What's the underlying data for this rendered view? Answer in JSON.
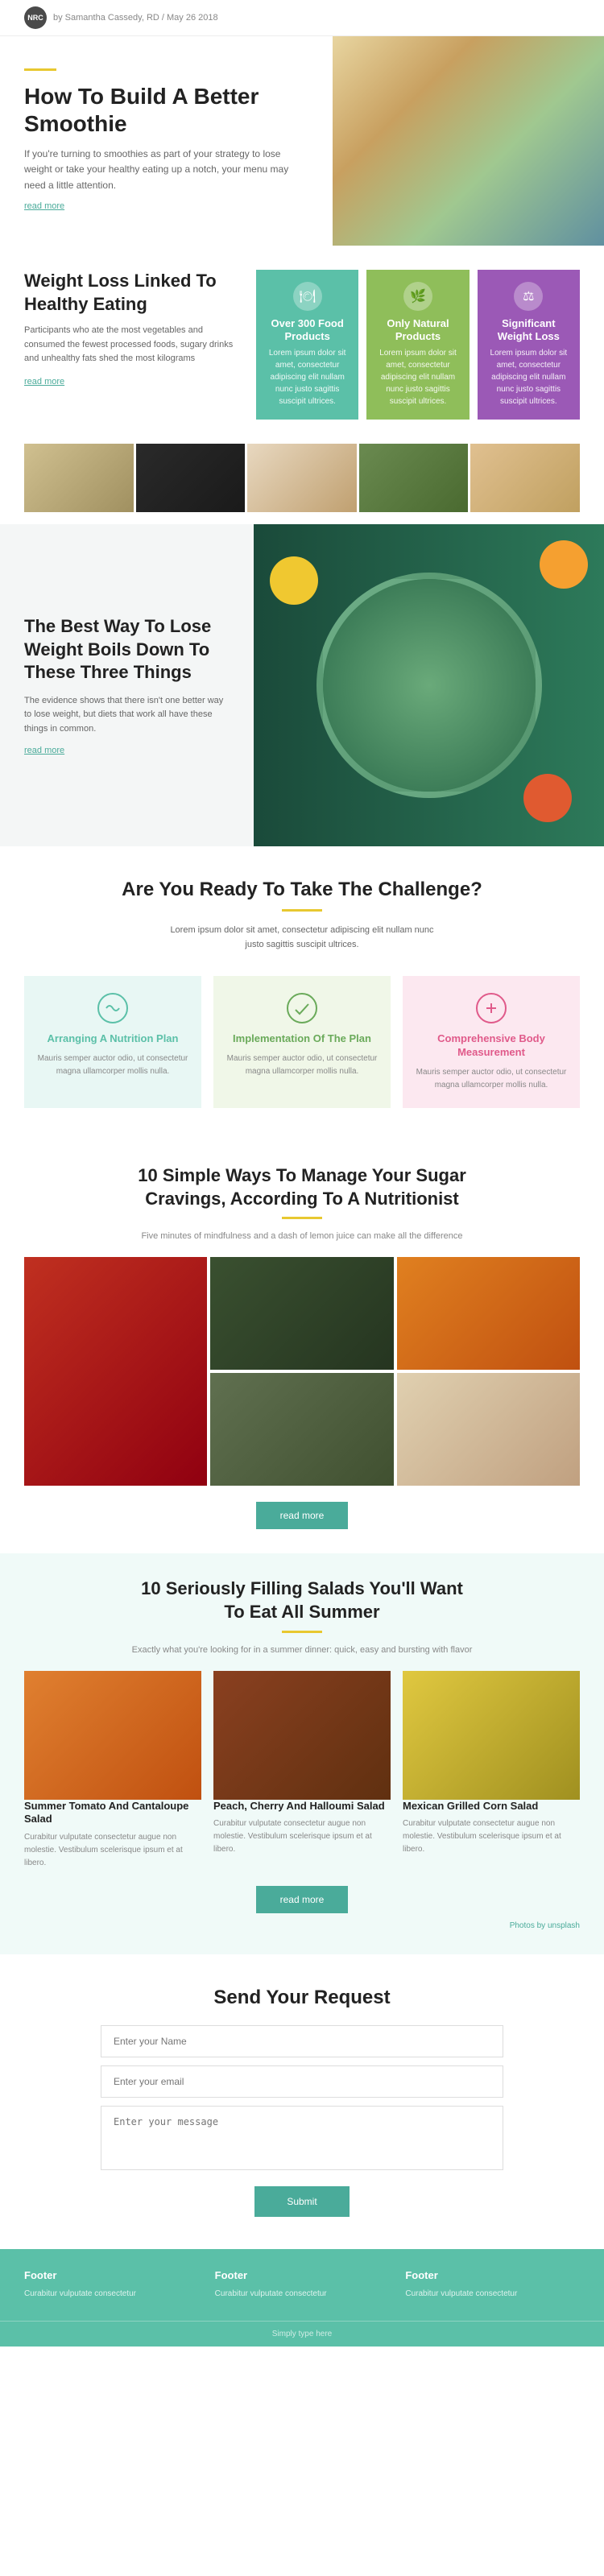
{
  "topbar": {
    "author": "by Samantha Cassedy, RD / May 26 2018",
    "logo_text": "NRC"
  },
  "hero": {
    "title": "How To Build A Better Smoothie",
    "description": "If you're turning to smoothies as part of your strategy to lose weight or take your healthy eating up a notch, your menu may need a little attention.",
    "read_more": "read more"
  },
  "weight_loss": {
    "title": "Weight Loss Linked To Healthy Eating",
    "description": "Participants who ate the most vegetables and consumed the fewest processed foods, sugary drinks and unhealthy fats shed the most kilograms",
    "read_more": "read more",
    "card1": {
      "title": "Over 300 Food Products",
      "body": "Lorem ipsum dolor sit amet, consectetur adipiscing elit nullam nunc justo sagittis suscipit ultrices."
    },
    "card2": {
      "title": "Only Natural Products",
      "body": "Lorem ipsum dolor sit amet, consectetur adipiscing elit nullam nunc justo sagittis suscipit ultrices."
    },
    "card3": {
      "title": "Significant Weight Loss",
      "body": "Lorem ipsum dolor sit amet, consectetur adipiscing elit nullam nunc justo sagittis suscipit ultrices."
    }
  },
  "banner": {
    "title": "The Best Way To Lose Weight Boils Down To These Three Things",
    "description": "The evidence shows that there isn't one better way to lose weight, but diets that work all have these things in common.",
    "read_more": "read more"
  },
  "challenge": {
    "title": "Are You Ready To Take The Challenge?",
    "subtitle": "Lorem ipsum dolor sit amet, consectetur adipiscing elit nullam nunc justo sagittis suscipit ultrices.",
    "card1": {
      "title": "Arranging A Nutrition Plan",
      "body": "Mauris semper auctor odio, ut consectetur magna ullamcorper mollis nulla."
    },
    "card2": {
      "title": "Implementation Of The Plan",
      "body": "Mauris semper auctor odio, ut consectetur magna ullamcorper mollis nulla."
    },
    "card3": {
      "title": "Comprehensive Body Measurement",
      "body": "Mauris semper auctor odio, ut consectetur magna ullamcorper mollis nulla."
    }
  },
  "sugar": {
    "title": "10 Simple Ways To Manage Your Sugar Cravings, According To A Nutritionist",
    "subtitle": "Five minutes of mindfulness and a dash of lemon juice can make all the difference",
    "read_more": "read more"
  },
  "salads": {
    "title": "10 Seriously Filling Salads You'll Want To Eat All Summer",
    "subtitle": "Exactly what you're looking for in a summer dinner: quick, easy and bursting with flavor",
    "read_more": "read more",
    "photos_credit": "Photos by",
    "photos_link": "unsplash",
    "card1": {
      "title": "Summer Tomato And Cantaloupe Salad",
      "body": "Curabitur vulputate consectetur augue non molestie. Vestibulum scelerisque ipsum et at libero."
    },
    "card2": {
      "title": "Peach, Cherry And Halloumi Salad",
      "body": "Curabitur vulputate consectetur augue non molestie. Vestibulum scelerisque ipsum et at libero."
    },
    "card3": {
      "title": "Mexican Grilled Corn Salad",
      "body": "Curabitur vulputate consectetur augue non molestie. Vestibulum scelerisque ipsum et at libero."
    }
  },
  "contact": {
    "title": "Send Your Request",
    "fields": {
      "name": "Enter your Name",
      "email": "Enter your email",
      "message": "Enter your message"
    },
    "submit": "Submit"
  },
  "footer": {
    "col1": {
      "title": "Footer",
      "text": "Curabitur vulputate consectetur"
    },
    "col2": {
      "title": "Footer",
      "text": "Curabitur vulputate consectetur"
    },
    "col3": {
      "title": "Footer",
      "text": "Curabitur vulputate consectetur"
    },
    "bottom": "Simply type here"
  }
}
